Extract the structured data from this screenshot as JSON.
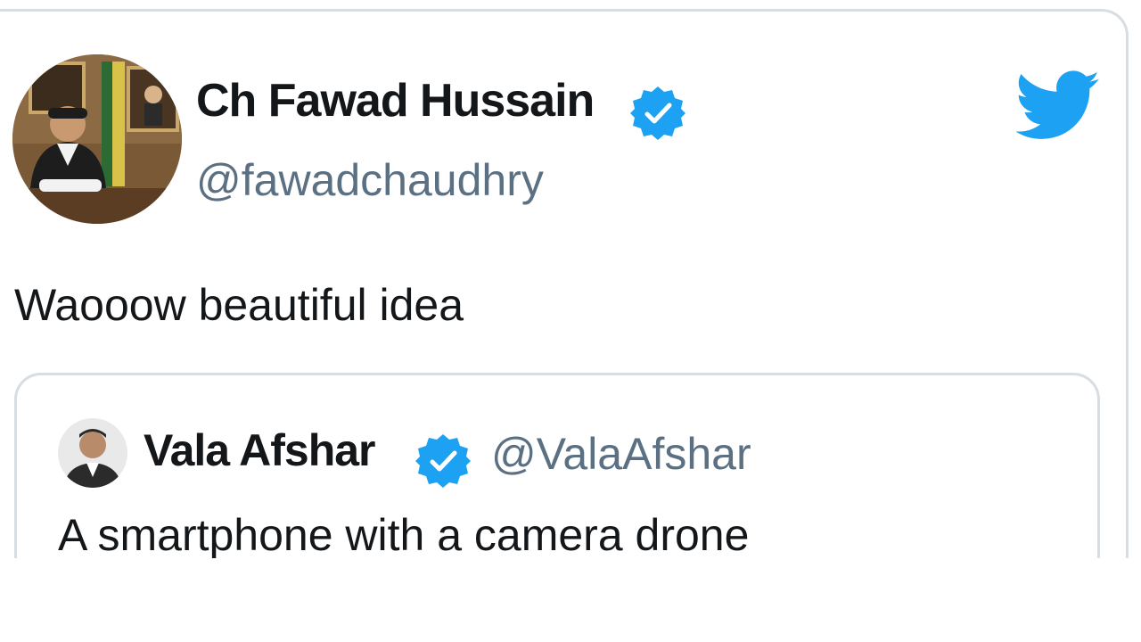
{
  "tweet": {
    "author": {
      "name": "Ch Fawad Hussain",
      "handle": "@fawadchaudhry",
      "verified": true,
      "avatar_icon": "profile-photo"
    },
    "text": "Waooow beautiful idea",
    "logo_icon": "twitter-bird-icon",
    "quoted_tweet": {
      "author": {
        "name": "Vala Afshar",
        "handle": "@ValaAfshar",
        "verified": true,
        "avatar_icon": "profile-photo"
      },
      "text": "A smartphone with a camera drone"
    }
  },
  "colors": {
    "twitter_blue": "#1da1f2",
    "text_primary": "#14171a",
    "text_secondary": "#5b7083",
    "border": "#d6dde3"
  }
}
